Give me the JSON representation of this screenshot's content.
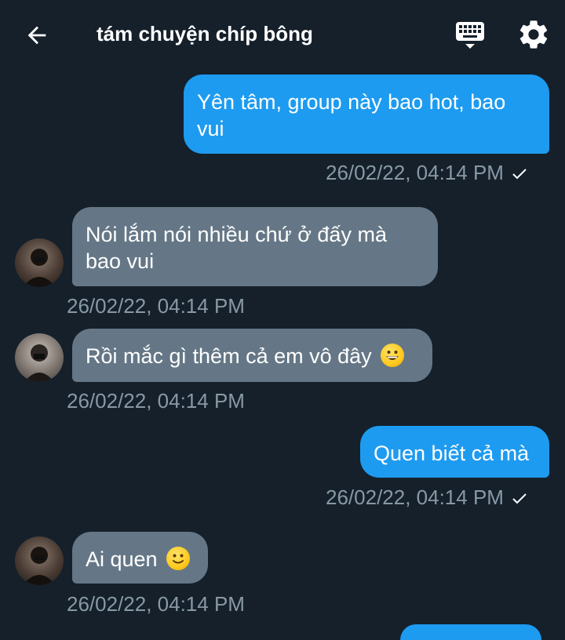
{
  "header": {
    "title": "tám chuyện chíp bông",
    "back_icon": "arrow-left-icon",
    "keyboard_icon": "keyboard-icon",
    "settings_icon": "gear-icon"
  },
  "colors": {
    "background": "#15202b",
    "outgoing_bubble": "#1d9bf0",
    "incoming_bubble": "#657786",
    "timestamp": "#8899a6"
  },
  "messages": [
    {
      "direction": "out",
      "text": "Yên tâm, group này bao hot, bao vui",
      "time": "26/02/22, 04:14 PM",
      "status_icon": "checkmark-icon"
    },
    {
      "direction": "in",
      "text": "Nói lắm nói nhiều chứ ở đấy mà bao vui",
      "time": "26/02/22, 04:14 PM",
      "avatar": "avatar"
    },
    {
      "direction": "in",
      "text": "Rồi mắc gì thêm cả em vô đây",
      "emoji": "grinning-face-emoji",
      "time": "26/02/22, 04:14 PM",
      "avatar": "avatar"
    },
    {
      "direction": "out",
      "text": "Quen biết cả mà",
      "time": "26/02/22, 04:14 PM",
      "status_icon": "checkmark-icon"
    },
    {
      "direction": "in",
      "text": "Ai quen",
      "emoji": "slightly-smiling-face-emoji",
      "time": "26/02/22, 04:14 PM",
      "avatar": "avatar"
    }
  ]
}
